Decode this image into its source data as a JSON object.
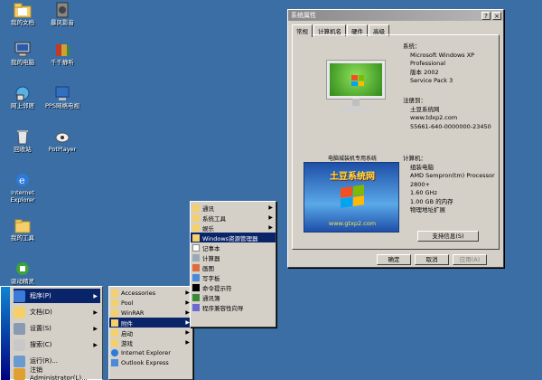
{
  "desktop_icons": [
    {
      "name": "我的文档",
      "icon": "folder-documents-icon",
      "color": "#f5d06a"
    },
    {
      "name": "我的电脑",
      "icon": "my-computer-icon",
      "color": "#9fb8d8"
    },
    {
      "name": "网上邻居",
      "icon": "network-places-icon",
      "color": "#5ab0e0"
    },
    {
      "name": "回收站",
      "icon": "recycle-bin-icon",
      "color": "#dfe6ee"
    },
    {
      "name": "Internet Explorer",
      "icon": "ie-icon",
      "color": "#2f7ad8"
    },
    {
      "name": "我的工具",
      "icon": "tool-folder-icon",
      "color": "#f5d06a"
    },
    {
      "name": "驱动精灵",
      "icon": "driver-icon",
      "color": "#3aa33a"
    },
    {
      "name": "暴风影音",
      "icon": "media-player-icon",
      "color": "#888888"
    },
    {
      "name": "千千静听",
      "icon": "music-player-icon",
      "color": "#d0a030"
    },
    {
      "name": "PPS网络电视",
      "icon": "pps-icon",
      "color": "#3070c0"
    },
    {
      "name": "PotPlayer",
      "icon": "potplayer-icon",
      "color": "#f0f0f0"
    }
  ],
  "window": {
    "title": "系统属性",
    "help": "?",
    "close": "×",
    "tabs": [
      "常规",
      "计算机名",
      "硬件",
      "高级"
    ],
    "system_label": "系统：",
    "system_lines": [
      "Microsoft Windows XP",
      "Professional",
      "版本 2002",
      "Service Pack 3"
    ],
    "user_label": "注册到：",
    "user_lines": [
      "土豆系统网",
      "www.tdxp2.com",
      "55661-640-0000000-23450"
    ],
    "computer_label": "计算机：",
    "computer_lines": [
      "组装电脑",
      "AMD Sempron(tm) Processor",
      "2800+",
      "1.60 GHz",
      "1.00 GB 的内存",
      "物理地址扩展"
    ],
    "support_button": "支持信息(S)",
    "banner_caption": "电脑城装机专用系统",
    "banner_title": "土豆系统网",
    "banner_url": "www.gtxp2.com",
    "ok": "确定",
    "cancel": "取消",
    "apply": "应用(A)"
  },
  "start_menu": {
    "items": [
      "程序(P)",
      "文档(D)",
      "设置(S)",
      "搜索(C)",
      "运行(R)...",
      "注销 Administrator(L)..."
    ]
  },
  "programs_menu": {
    "items": [
      "Accessories",
      "Pool",
      "WinRAR",
      "附件",
      "启动",
      "游戏",
      "Internet Explorer",
      "Outlook Express"
    ]
  },
  "accessories_menu": {
    "items": [
      "通讯",
      "系统工具",
      "娱乐",
      "Windows资源管理器",
      "记事本",
      "计算器",
      "画图",
      "写字板",
      "命令提示符",
      "通讯簿",
      "程序兼容性向导"
    ]
  },
  "colors": {
    "desktop": "#3a6ea5",
    "selection": "#0a246a"
  }
}
